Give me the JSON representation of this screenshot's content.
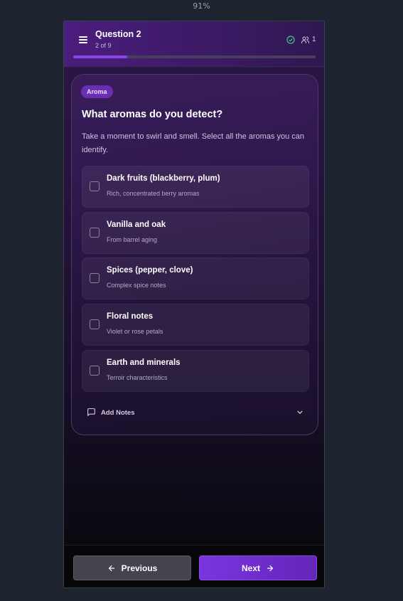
{
  "browser": {
    "zoom": "91%"
  },
  "header": {
    "title": "Question 2",
    "subtitle": "2 of 9",
    "participants": "1",
    "progress_fraction": 0.222
  },
  "card": {
    "badge": "Aroma",
    "title": "What aromas do you detect?",
    "description": "Take a moment to swirl and smell. Select all the aromas you can identify.",
    "options": [
      {
        "title": "Dark fruits (blackberry, plum)",
        "subtitle": "Rich, concentrated berry aromas"
      },
      {
        "title": "Vanilla and oak",
        "subtitle": "From barrel aging"
      },
      {
        "title": "Spices (pepper, clove)",
        "subtitle": "Complex spice notes"
      },
      {
        "title": "Floral notes",
        "subtitle": "Violet or rose petals"
      },
      {
        "title": "Earth and minerals",
        "subtitle": "Terroir characteristics"
      }
    ],
    "notes_label": "Add Notes"
  },
  "footer": {
    "previous_label": "Previous",
    "next_label": "Next"
  },
  "icons": {
    "menu": "menu-icon",
    "connected": "check-circle-icon",
    "participants": "users-icon",
    "notes": "message-square-icon",
    "expand": "chevron-down-icon",
    "previous": "arrow-left-icon",
    "next": "arrow-right-icon"
  },
  "colors": {
    "accent": "#7a35e0",
    "badge": "#6a2fb0",
    "connected": "#3ec98a"
  }
}
